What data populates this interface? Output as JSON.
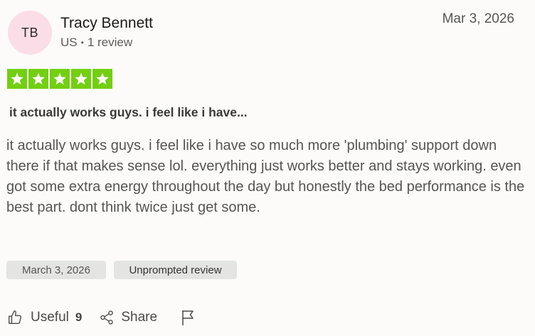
{
  "reviewer": {
    "initials": "TB",
    "name": "Tracy Bennett",
    "country": "US",
    "review_count": "1 review",
    "avatar_color": "#fbdde7"
  },
  "review": {
    "date_short": "Mar 3, 2026",
    "rating": 5,
    "rating_max": 5,
    "star_color": "#73cf11",
    "title": "it actually works guys. i feel like i have...",
    "body": "it actually works guys. i feel like i have so much more 'plumbing' support down there if that makes sense lol. everything just works better and stays working. even got some extra energy throughout the day but honestly the bed performance is the best part. dont think twice just get some.",
    "date_long": "March 3, 2026",
    "tag": "Unprompted review"
  },
  "actions": {
    "useful_label": "Useful",
    "useful_count": "9",
    "share_label": "Share",
    "useful_icon": "thumbs-up-icon",
    "share_icon": "share-icon",
    "report_icon": "flag-icon"
  }
}
